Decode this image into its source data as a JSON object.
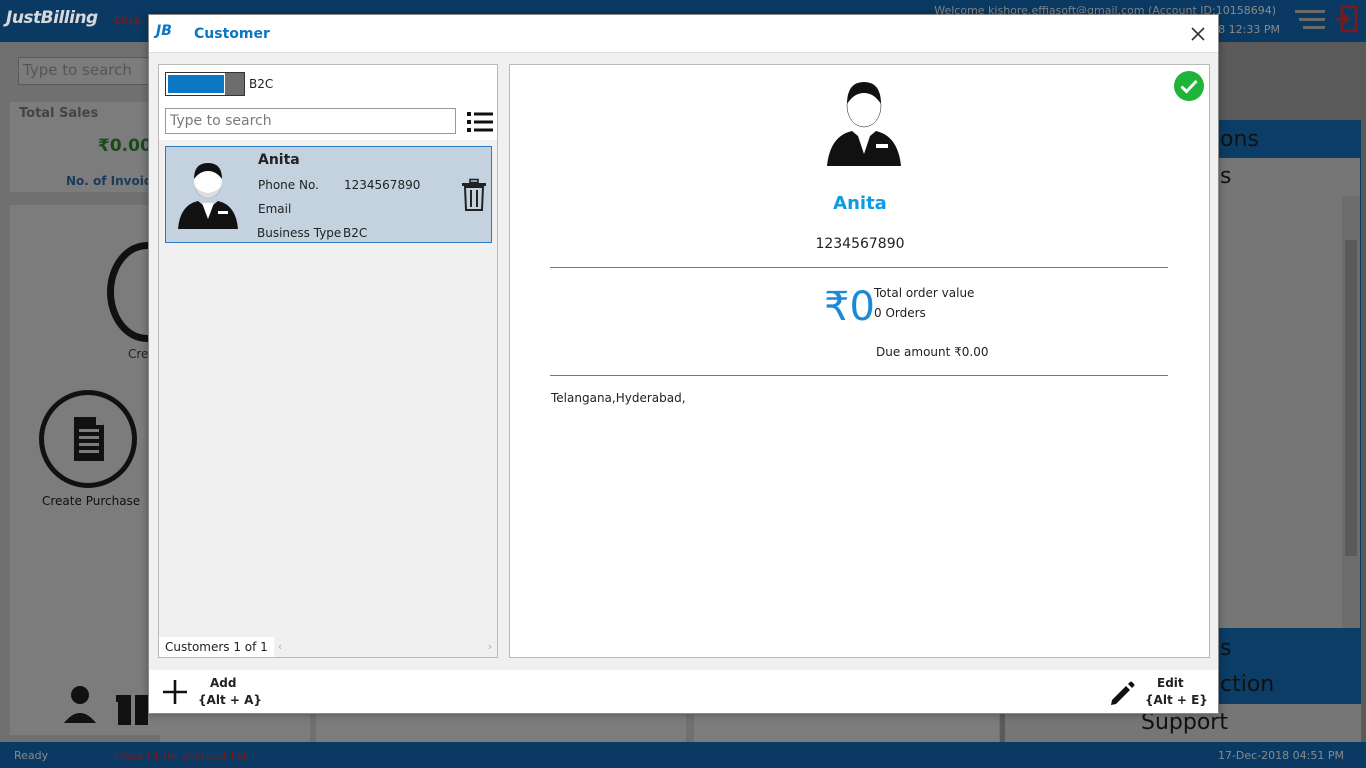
{
  "app": {
    "logo": "JustBilling",
    "click_hint": "Click",
    "welcome": "Welcome kishore.effiasoft@gmail.com (Account ID:10158694)",
    "datetime_top": "18 12:33 PM",
    "search_placeholder": "Type to search",
    "total_sales_label": "Total Sales",
    "total_sales_amount": "₹0.00",
    "invoices_label": "No. of Invoic",
    "cre_label": "Cre",
    "create_purchase_label": "Create Purchase",
    "right_text_1": "ons",
    "right_text_2": "s",
    "right_text_3": "s",
    "right_text_4": "ction",
    "support_label": "Support",
    "status_ready": "Ready",
    "status_hint": "Press F1 for shortcut list",
    "status_time": "17-Dec-2018 04:51 PM"
  },
  "dialog": {
    "title": "Customer",
    "logo_text": "JB"
  },
  "list": {
    "toggle_label": "B2C",
    "search_placeholder": "Type to search",
    "count_label": "Customers 1 of 1",
    "customers": [
      {
        "name": "Anita",
        "phone_label": "Phone No.",
        "phone": "1234567890",
        "email_label": "Email",
        "business_type_label": "Business Type",
        "business_type": "B2C"
      }
    ]
  },
  "detail": {
    "name": "Anita",
    "phone": "1234567890",
    "total_amount": "₹0",
    "total_label": "Total order value",
    "orders": "0 Orders",
    "due": "Due amount ₹0.00",
    "address": "Telangana,Hyderabad,"
  },
  "footer": {
    "add_label": "Add",
    "add_shortcut": "{Alt + A}",
    "edit_label": "Edit",
    "edit_shortcut": "{Alt + E}"
  },
  "colors": {
    "accent": "#0b77c2",
    "name_blue": "#0b9be0",
    "selected_row": "#c4d2e0",
    "check_green": "#1fb33a",
    "header_bg": "#0a3a63"
  }
}
